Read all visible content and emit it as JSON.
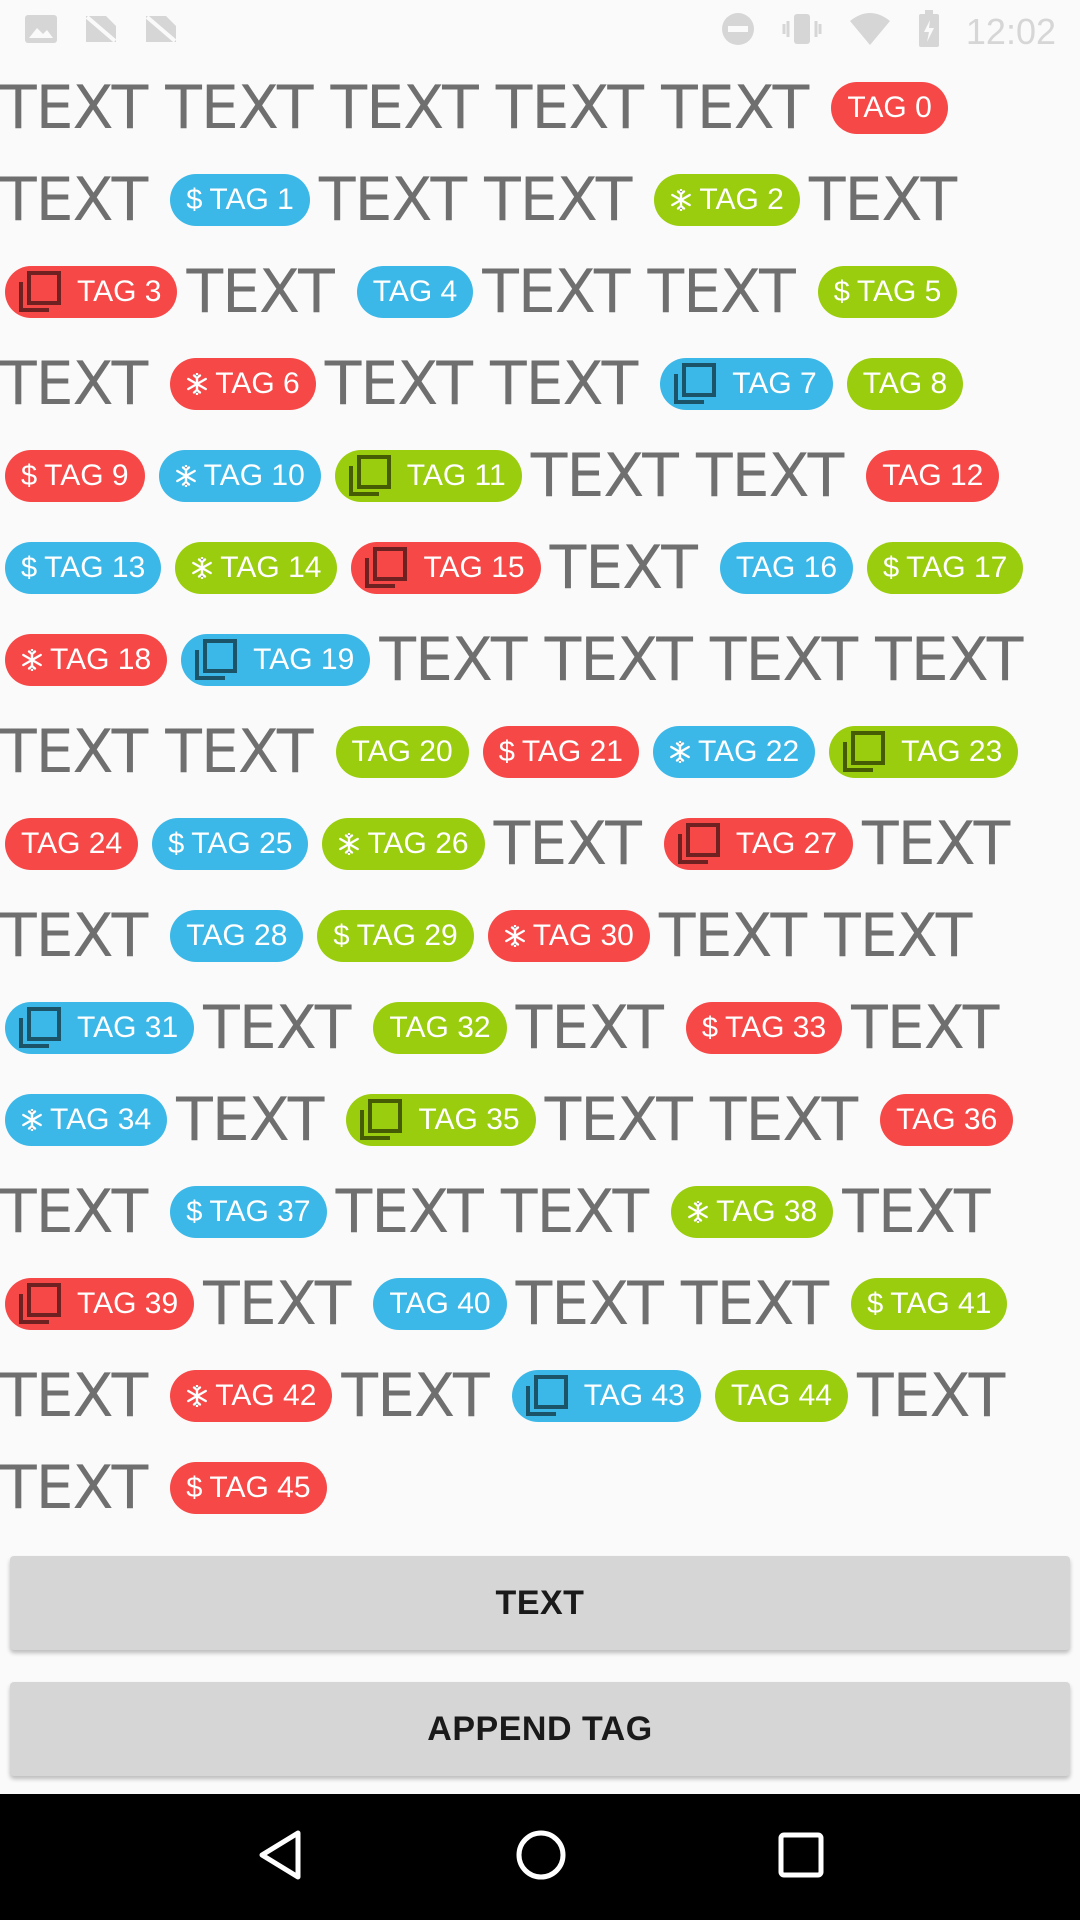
{
  "status_bar": {
    "time": "12:02"
  },
  "colors": {
    "red": "#f74848",
    "blue": "#3cb8e8",
    "green": "#9acd0d",
    "text": "#6f6f6f"
  },
  "lines": [
    [
      {
        "t": "w",
        "text": "TEXT"
      },
      {
        "t": "w",
        "text": "TEXT"
      },
      {
        "t": "w",
        "text": "TEXT"
      },
      {
        "t": "w",
        "text": "TEXT"
      },
      {
        "t": "w",
        "text": "TEXT"
      },
      {
        "t": "tag",
        "text": "TAG 0",
        "color": "red",
        "icon": "none"
      }
    ],
    [
      {
        "t": "w",
        "text": "TEXT"
      },
      {
        "t": "tag",
        "text": "TAG 1",
        "color": "blue",
        "icon": "dollar"
      },
      {
        "t": "w",
        "text": "TEXT"
      },
      {
        "t": "w",
        "text": "TEXT"
      },
      {
        "t": "tag",
        "text": "TAG 2",
        "color": "green",
        "icon": "snowflake"
      },
      {
        "t": "w",
        "text": "TEXT"
      }
    ],
    [
      {
        "t": "tag",
        "text": "TAG 3",
        "color": "red",
        "icon": "gallery"
      },
      {
        "t": "w",
        "text": "TEXT"
      },
      {
        "t": "tag",
        "text": "TAG 4",
        "color": "blue",
        "icon": "none"
      },
      {
        "t": "w",
        "text": "TEXT"
      },
      {
        "t": "w",
        "text": "TEXT"
      },
      {
        "t": "tag",
        "text": "TAG 5",
        "color": "green",
        "icon": "dollar"
      }
    ],
    [
      {
        "t": "w",
        "text": "TEXT"
      },
      {
        "t": "tag",
        "text": "TAG 6",
        "color": "red",
        "icon": "snowflake"
      },
      {
        "t": "w",
        "text": "TEXT"
      },
      {
        "t": "w",
        "text": "TEXT"
      },
      {
        "t": "tag",
        "text": "TAG 7",
        "color": "blue",
        "icon": "gallery"
      },
      {
        "t": "tag",
        "text": "TAG 8",
        "color": "green",
        "icon": "none"
      }
    ],
    [
      {
        "t": "tag",
        "text": "TAG 9",
        "color": "red",
        "icon": "dollar"
      },
      {
        "t": "tag",
        "text": "TAG 10",
        "color": "blue",
        "icon": "snowflake"
      },
      {
        "t": "tag",
        "text": "TAG 11",
        "color": "green",
        "icon": "gallery"
      },
      {
        "t": "w",
        "text": "TEXT"
      },
      {
        "t": "w",
        "text": "TEXT"
      },
      {
        "t": "tag",
        "text": "TAG 12",
        "color": "red",
        "icon": "none"
      }
    ],
    [
      {
        "t": "tag",
        "text": "TAG 13",
        "color": "blue",
        "icon": "dollar"
      },
      {
        "t": "tag",
        "text": "TAG 14",
        "color": "green",
        "icon": "snowflake"
      },
      {
        "t": "tag",
        "text": "TAG 15",
        "color": "red",
        "icon": "gallery"
      },
      {
        "t": "w",
        "text": "TEXT"
      },
      {
        "t": "tag",
        "text": "TAG 16",
        "color": "blue",
        "icon": "none"
      },
      {
        "t": "tag",
        "text": "TAG 17",
        "color": "green",
        "icon": "dollar"
      }
    ],
    [
      {
        "t": "tag",
        "text": "TAG 18",
        "color": "red",
        "icon": "snowflake"
      },
      {
        "t": "tag",
        "text": "TAG 19",
        "color": "blue",
        "icon": "gallery"
      },
      {
        "t": "w",
        "text": "TEXT"
      },
      {
        "t": "w",
        "text": "TEXT"
      },
      {
        "t": "w",
        "text": "TEXT"
      },
      {
        "t": "w",
        "text": "TEXT"
      }
    ],
    [
      {
        "t": "w",
        "text": "TEXT"
      },
      {
        "t": "w",
        "text": "TEXT"
      },
      {
        "t": "tag",
        "text": "TAG 20",
        "color": "green",
        "icon": "none"
      },
      {
        "t": "tag",
        "text": "TAG 21",
        "color": "red",
        "icon": "dollar"
      },
      {
        "t": "tag",
        "text": "TAG 22",
        "color": "blue",
        "icon": "snowflake"
      },
      {
        "t": "tag",
        "text": "TAG 23",
        "color": "green",
        "icon": "gallery"
      }
    ],
    [
      {
        "t": "tag",
        "text": "TAG 24",
        "color": "red",
        "icon": "none"
      },
      {
        "t": "tag",
        "text": "TAG 25",
        "color": "blue",
        "icon": "dollar"
      },
      {
        "t": "tag",
        "text": "TAG 26",
        "color": "green",
        "icon": "snowflake"
      },
      {
        "t": "w",
        "text": "TEXT"
      },
      {
        "t": "tag",
        "text": "TAG 27",
        "color": "red",
        "icon": "gallery"
      },
      {
        "t": "w",
        "text": "TEXT"
      }
    ],
    [
      {
        "t": "w",
        "text": "TEXT"
      },
      {
        "t": "tag",
        "text": "TAG 28",
        "color": "blue",
        "icon": "none"
      },
      {
        "t": "tag",
        "text": "TAG 29",
        "color": "green",
        "icon": "dollar"
      },
      {
        "t": "tag",
        "text": "TAG 30",
        "color": "red",
        "icon": "snowflake"
      },
      {
        "t": "w",
        "text": "TEXT"
      },
      {
        "t": "w",
        "text": "TEXT"
      }
    ],
    [
      {
        "t": "tag",
        "text": "TAG 31",
        "color": "blue",
        "icon": "gallery"
      },
      {
        "t": "w",
        "text": "TEXT"
      },
      {
        "t": "tag",
        "text": "TAG 32",
        "color": "green",
        "icon": "none"
      },
      {
        "t": "w",
        "text": "TEXT"
      },
      {
        "t": "tag",
        "text": "TAG 33",
        "color": "red",
        "icon": "dollar"
      },
      {
        "t": "w",
        "text": "TEXT"
      }
    ],
    [
      {
        "t": "tag",
        "text": "TAG 34",
        "color": "blue",
        "icon": "snowflake"
      },
      {
        "t": "w",
        "text": "TEXT"
      },
      {
        "t": "tag",
        "text": "TAG 35",
        "color": "green",
        "icon": "gallery"
      },
      {
        "t": "w",
        "text": "TEXT"
      },
      {
        "t": "w",
        "text": "TEXT"
      },
      {
        "t": "tag",
        "text": "TAG 36",
        "color": "red",
        "icon": "none"
      }
    ],
    [
      {
        "t": "w",
        "text": "TEXT"
      },
      {
        "t": "tag",
        "text": "TAG 37",
        "color": "blue",
        "icon": "dollar"
      },
      {
        "t": "w",
        "text": "TEXT"
      },
      {
        "t": "w",
        "text": "TEXT"
      },
      {
        "t": "tag",
        "text": "TAG 38",
        "color": "green",
        "icon": "snowflake"
      },
      {
        "t": "w",
        "text": "TEXT"
      }
    ],
    [
      {
        "t": "tag",
        "text": "TAG 39",
        "color": "red",
        "icon": "gallery"
      },
      {
        "t": "w",
        "text": "TEXT"
      },
      {
        "t": "tag",
        "text": "TAG 40",
        "color": "blue",
        "icon": "none"
      },
      {
        "t": "w",
        "text": "TEXT"
      },
      {
        "t": "w",
        "text": "TEXT"
      },
      {
        "t": "tag",
        "text": "TAG 41",
        "color": "green",
        "icon": "dollar"
      }
    ],
    [
      {
        "t": "w",
        "text": "TEXT"
      },
      {
        "t": "tag",
        "text": "TAG 42",
        "color": "red",
        "icon": "snowflake"
      },
      {
        "t": "w",
        "text": "TEXT"
      },
      {
        "t": "tag",
        "text": "TAG 43",
        "color": "blue",
        "icon": "gallery"
      },
      {
        "t": "tag",
        "text": "TAG 44",
        "color": "green",
        "icon": "none"
      },
      {
        "t": "w",
        "text": "TEXT"
      }
    ],
    [
      {
        "t": "w",
        "text": "TEXT"
      },
      {
        "t": "tag",
        "text": "TAG 45",
        "color": "red",
        "icon": "dollar"
      }
    ]
  ],
  "buttons": {
    "text_label": "TEXT",
    "append_label": "APPEND TAG"
  },
  "nav": {
    "back": "back-icon",
    "home": "home-icon",
    "recents": "recents-icon"
  }
}
